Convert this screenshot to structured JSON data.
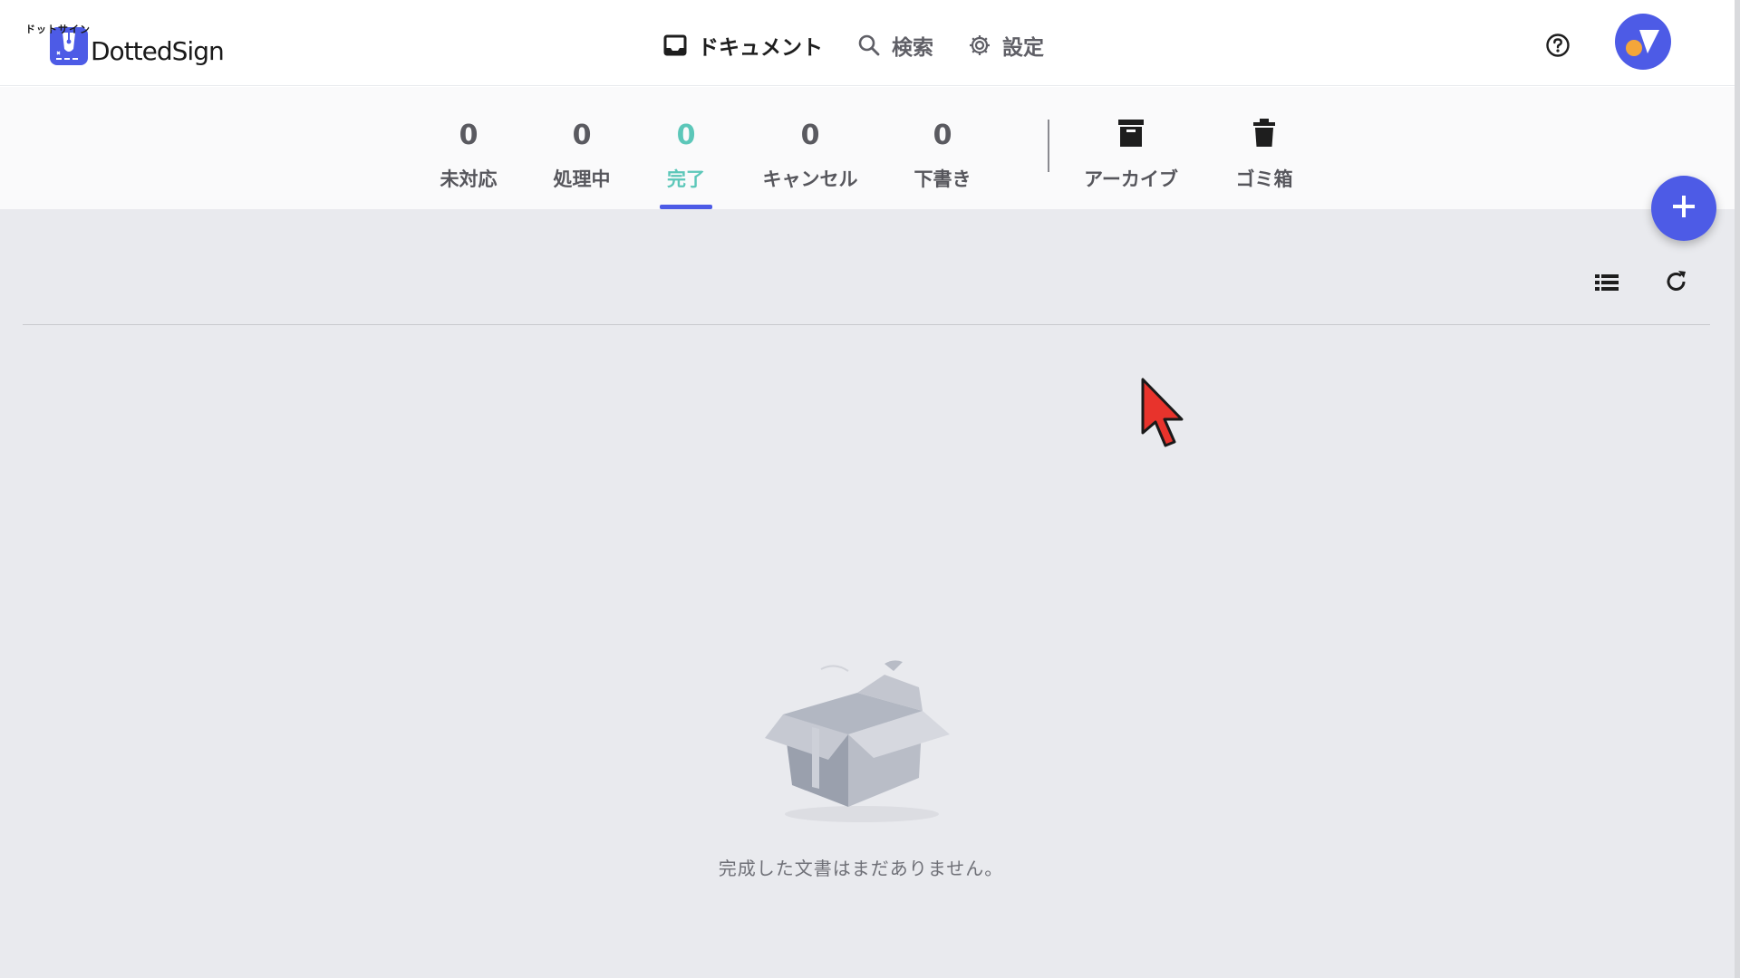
{
  "brand": {
    "name": "DottedSign",
    "ruby": "ドットサイン",
    "accent": "#4d5be6",
    "success": "#5cc7b9"
  },
  "nav": {
    "documents": {
      "label": "ドキュメント",
      "icon": "inbox-icon"
    },
    "search": {
      "label": "検索",
      "icon": "search-icon"
    },
    "settings": {
      "label": "設定",
      "icon": "gear-icon"
    }
  },
  "header": {
    "help_icon": "help-circle-icon",
    "avatar_icon": "avatar"
  },
  "tabs": [
    {
      "key": "pending",
      "count": "0",
      "label": "未対応"
    },
    {
      "key": "processing",
      "count": "0",
      "label": "処理中"
    },
    {
      "key": "completed",
      "count": "0",
      "label": "完了",
      "active": true
    },
    {
      "key": "cancelled",
      "count": "0",
      "label": "キャンセル"
    },
    {
      "key": "draft",
      "count": "0",
      "label": "下書き"
    },
    {
      "key": "archive",
      "label": "アーカイブ",
      "icon": "archive-icon"
    },
    {
      "key": "trash",
      "label": "ゴミ箱",
      "icon": "trash-icon"
    }
  ],
  "toolbar": {
    "add_icon": "plus-icon",
    "list_icon": "list-view-icon",
    "refresh_icon": "refresh-icon"
  },
  "empty": {
    "message": "完成した文書はまだありません。",
    "icon": "empty-box-icon"
  }
}
